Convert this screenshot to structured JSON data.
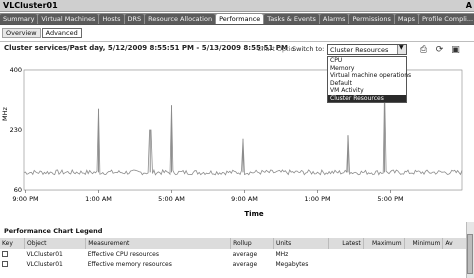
{
  "window": {
    "title": "VLCluster01",
    "corner": "A"
  },
  "tabs": [
    {
      "label": "Summary",
      "active": false
    },
    {
      "label": "Virtual Machines",
      "active": false
    },
    {
      "label": "Hosts",
      "active": false
    },
    {
      "label": "DRS",
      "active": false
    },
    {
      "label": "Resource Allocation",
      "active": false
    },
    {
      "label": "Performance",
      "active": true
    },
    {
      "label": "Tasks & Events",
      "active": false
    },
    {
      "label": "Alarms",
      "active": false
    },
    {
      "label": "Permissions",
      "active": false
    },
    {
      "label": "Maps",
      "active": false
    },
    {
      "label": "Profile Compli...",
      "active": false
    }
  ],
  "subtabs": [
    {
      "label": "Overview",
      "active": false
    },
    {
      "label": "Advanced",
      "active": true
    }
  ],
  "performance": {
    "header": "Cluster services/Past day, 5/12/2009 8:55:51 PM - 5/13/2009 8:55:51 PM",
    "chart_options": "Chart Optio",
    "switch_label": "Switch to:",
    "switch_value": "Cluster Resources",
    "dropdown_options": [
      "CPU",
      "Memory",
      "Virtual machine operations",
      "Default",
      "VM Activity",
      "Cluster Resources"
    ],
    "dropdown_selected": "Cluster Resources",
    "toolbar_icons": [
      "print-icon",
      "refresh-icon",
      "save-icon"
    ]
  },
  "chart_data": {
    "type": "line",
    "title": "",
    "xlabel": "Time",
    "ylabel": "MHz",
    "ylim": [
      60,
      400
    ],
    "yticks": [
      60,
      230,
      400
    ],
    "x_tick_labels": [
      "9:00 PM",
      "1:00 AM",
      "5:00 AM",
      "9:00 AM",
      "1:00 PM",
      "5:00 PM"
    ],
    "grid": true,
    "series": [
      {
        "color": "#8c8c8c",
        "baseline": 110,
        "spikes": [
          {
            "time": "1:00 AM",
            "value": 290
          },
          {
            "time": "3:50 AM",
            "value": 230
          },
          {
            "time": "5:00 AM",
            "value": 300
          },
          {
            "time": "8:55 AM",
            "value": 205
          },
          {
            "time": "2:40 PM",
            "value": 215
          },
          {
            "time": "4:40 PM",
            "value": 345
          }
        ]
      }
    ]
  },
  "legend": {
    "title": "Performance Chart Legend",
    "columns": [
      "Key",
      "Object",
      "Measurement",
      "Rollup",
      "Units",
      "Latest",
      "Maximum",
      "Minimum",
      "Av"
    ],
    "rows": [
      {
        "object": "VLCluster01",
        "measurement": "Effective CPU resources",
        "rollup": "average",
        "units": "MHz"
      },
      {
        "object": "VLCluster01",
        "measurement": "Effective memory resources",
        "rollup": "average",
        "units": "Megabytes"
      }
    ]
  }
}
